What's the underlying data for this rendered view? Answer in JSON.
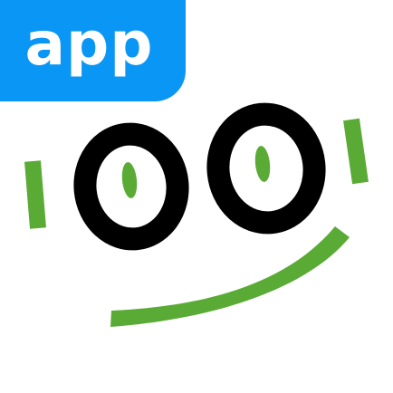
{
  "badge": {
    "label": "app"
  },
  "colors": {
    "badge": "#0a96f5",
    "ring": "#000000",
    "accent": "#5aab35",
    "background": "#ffffff"
  },
  "logo": {
    "mark": "smiling-face-logo"
  }
}
